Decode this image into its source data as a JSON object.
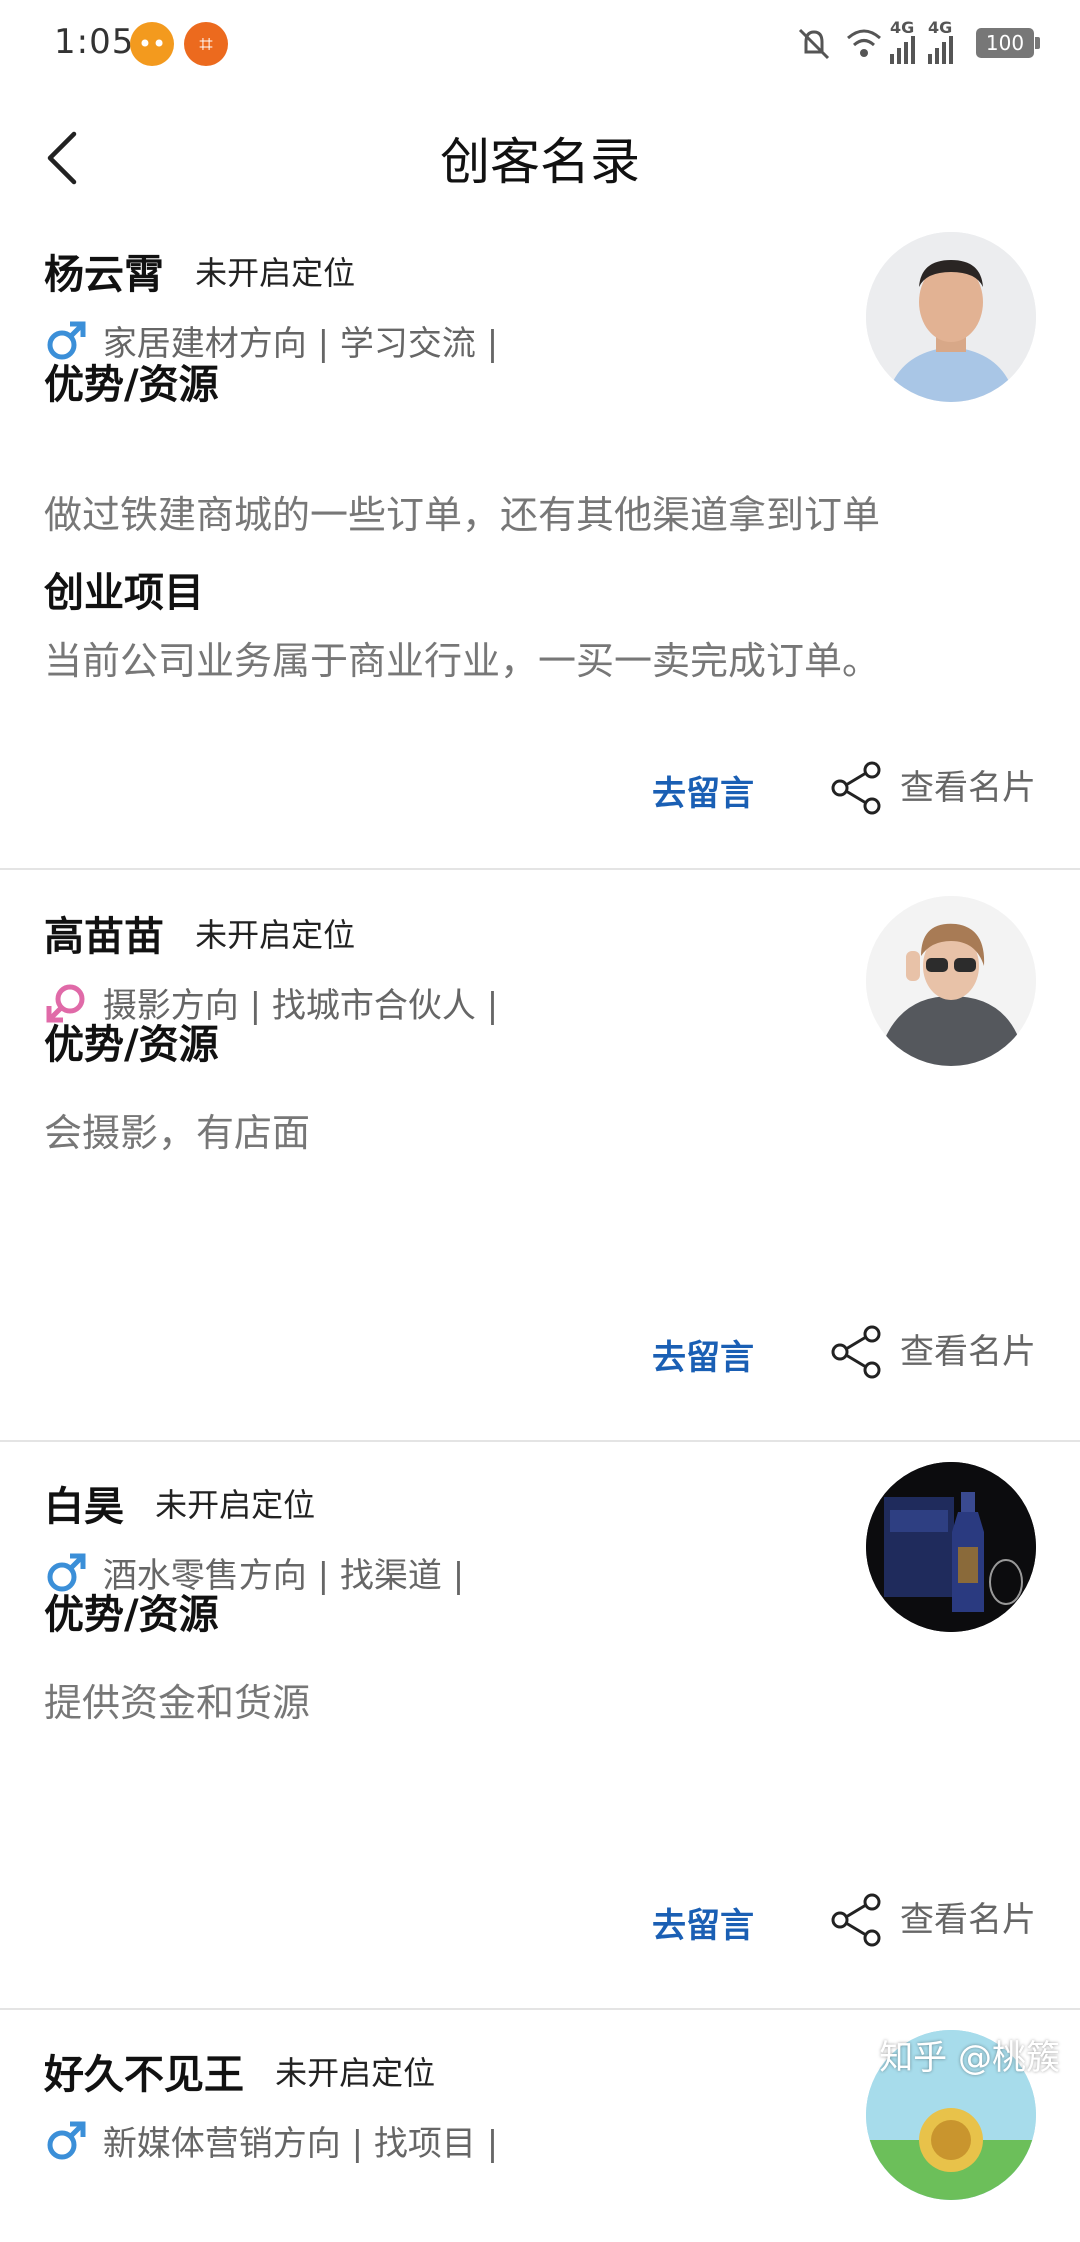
{
  "status_bar": {
    "time": "1:05",
    "battery": "100",
    "network_1": "4G",
    "network_2": "4G",
    "icons": [
      "chat-app-icon",
      "crop-app-icon",
      "mute-icon",
      "wifi-icon",
      "signal-icon",
      "battery-icon"
    ]
  },
  "header": {
    "title": "创客名录",
    "back_icon": "back-arrow-icon"
  },
  "colors": {
    "accent": "#1a5fb4",
    "male": "#3b8fd8",
    "female": "#e06aa8",
    "divider": "#e4e4e4"
  },
  "location_status": "未开启定位",
  "actions": {
    "message_label": "去留言",
    "card_label": "查看名片"
  },
  "section_labels": {
    "advantage": "优势/资源",
    "project": "创业项目"
  },
  "cards": [
    {
      "name": "杨云霄",
      "gender": "male",
      "tags": "家居建材方向 | 学习交流 |",
      "advantage": "做过铁建商城的一些订单，还有其他渠道拿到订单",
      "project": "当前公司业务属于商业行业，一买一卖完成订单。"
    },
    {
      "name": "高苗苗",
      "gender": "female",
      "tags": "摄影方向 | 找城市合伙人 |",
      "advantage": "会摄影，有店面"
    },
    {
      "name": "白昊",
      "gender": "male",
      "tags": "酒水零售方向 | 找渠道 |",
      "advantage": "提供资金和货源"
    },
    {
      "name": "好久不见王",
      "gender": "male",
      "tags": "新媒体营销方向 | 找项目 |"
    }
  ],
  "watermark": "知乎 @桃簇"
}
